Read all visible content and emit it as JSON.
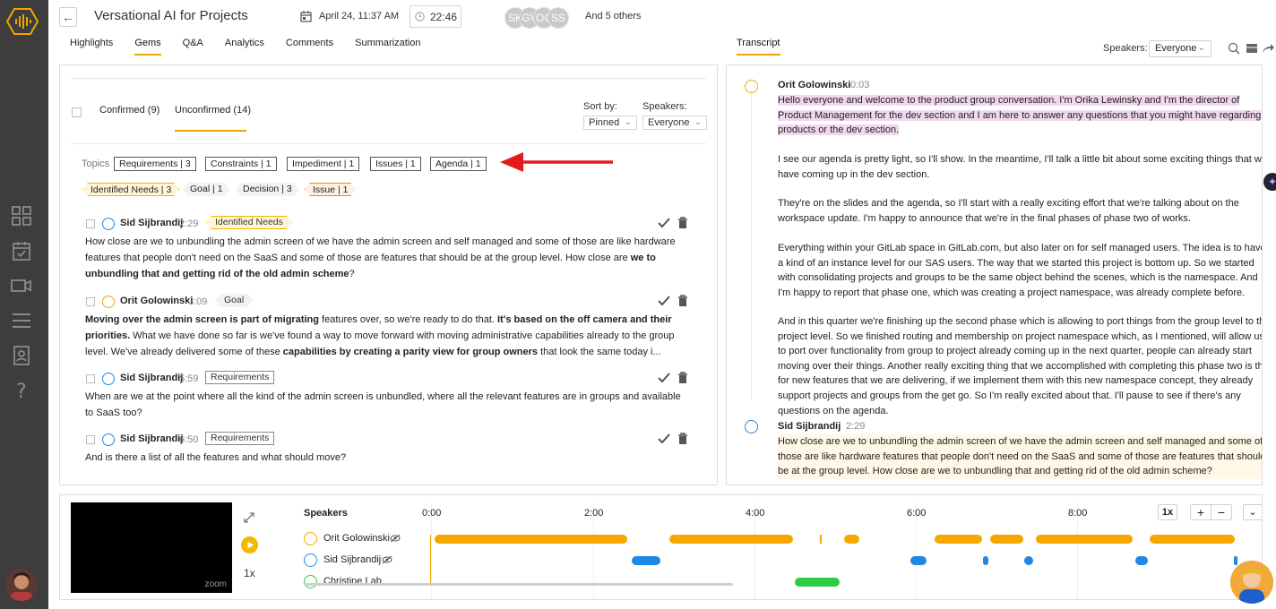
{
  "header": {
    "title": "Versational AI for Projects",
    "date": "April 24, 11:37 AM",
    "duration": "22:46",
    "participants": [
      "SK",
      "GV",
      "OC",
      "SS"
    ],
    "others": "And 5 others"
  },
  "tabs": [
    "Highlights",
    "Gems",
    "Q&A",
    "Analytics",
    "Comments",
    "Summarization"
  ],
  "transcript_header": {
    "tab": "Transcript",
    "speakers_label": "Speakers:",
    "speakers_value": "Everyone"
  },
  "gems_panel": {
    "confirmed": "Confirmed (9)",
    "unconfirmed": "Unconfirmed (14)",
    "sort_label": "Sort by:",
    "sort_value": "Pinned",
    "speakers_label": "Speakers:",
    "speakers_value": "Everyone",
    "topics_label": "Topics",
    "topics": [
      "Requirements | 3",
      "Constraints | 1",
      "Impediment | 1",
      "Issues | 1",
      "Agenda | 1"
    ],
    "tags": [
      "Identified Needs | 3",
      "Goal | 1",
      "Decision | 3",
      "Issue | 1"
    ],
    "gems": [
      {
        "speaker": "Sid Sijbrandij",
        "time": "2:29",
        "tag": "Identified Needs",
        "text_a": "How close are we to unbundling the admin screen of we have the admin screen and self managed and some of those are like hardware features that people don't need on the SaaS and some of those are features that should be at the group level. How close are ",
        "text_b": "we to unbundling that and getting rid of the old admin scheme",
        "text_c": "?"
      },
      {
        "speaker": "Orit Golowinski",
        "time": "3:09",
        "tag": "Goal",
        "text_a": "Moving over the admin screen is part of migrating",
        "text_b": " features over, so we're ready to do that. ",
        "text_c": "It's based on the off camera and their priorities.",
        "text_d": " What we have done so far is we've found a way to move forward with moving administrative capabilities already to the group level. We've already delivered some of these ",
        "text_e": "capabilities by creating a parity view for group owners",
        "text_f": " that look the same today i..."
      },
      {
        "speaker": "Sid Sijbrandij",
        "time": "5:59",
        "tag": "Requirements",
        "text": "When are we at the point where all the kind of the admin screen is unbundled, where all the relevant features are in groups and available to SaaS too?"
      },
      {
        "speaker": "Sid Sijbrandij",
        "time": "6:50",
        "tag": "Requirements",
        "text": "And is there a list of all the features and what should move?"
      }
    ]
  },
  "transcript": [
    {
      "speaker": "Orit Golowinski",
      "time": "0:03",
      "highlight": "Hello everyone and welcome to the product group conversation. I'm Orika Lewinsky and I'm the director of Product Management for the dev section and I am here to answer any questions that you might have regarding products or the dev section.",
      "paragraphs": [
        "I see our agenda is pretty light, so I'll show. In the meantime, I'll talk a little bit about some exciting things that we have coming up in the dev section.",
        "They're on the slides and the agenda, so I'll start with a really exciting effort that we're talking about on the workspace update. I'm happy to announce that we're in the final phases of phase two of works.",
        "Everything within your GitLab space in GitLab.com, but also later on for self managed users. The idea is to have a kind of an instance level for our SAS users. The way that we started this project is bottom up. So we started with consolidating projects and groups to be the same object behind the scenes, which is the namespace. And I'm happy to report that phase one, which was creating a project namespace, was already complete before.",
        "And in this quarter we're finishing up the second phase which is allowing to port things from the group level to the project level. So we finished routing and membership on project namespace which, as I mentioned, will allow us to port over functionality from group to project already coming up in the next quarter, people can already start moving over their things. Another really exciting thing that we accomplished with completing this phase two is that for new features that we are delivering, if we implement them with this new namespace concept, they already support projects and groups from the get go. So I'm really excited about that. I'll pause to see if there's any questions on the agenda."
      ]
    },
    {
      "speaker": "Sid Sijbrandij",
      "time": "2:29",
      "highlight": "How close are we to unbundling the admin screen of we have the admin screen and self managed and some of those are like hardware features that people don't need on the SaaS and some of those are features that should be at the group level. How close are we to unbundling that and getting rid of the old admin scheme?"
    }
  ],
  "player": {
    "speakers_heading": "Speakers",
    "speakers": [
      "Orit Golowinski",
      "Sid Sijbrandij",
      "Christine Lab"
    ],
    "axis": [
      "0:00",
      "2:00",
      "4:00",
      "6:00",
      "8:00"
    ],
    "speed": "1x",
    "zoom_label": "zoom",
    "speed_ctrl": "1x",
    "plus": "+",
    "minus": "−"
  },
  "colors": {
    "accent": "#f0a500",
    "orit": "#f5a700",
    "sid": "#1e88e5",
    "christine": "#2ecc40",
    "rail": "#3d3d3d"
  }
}
